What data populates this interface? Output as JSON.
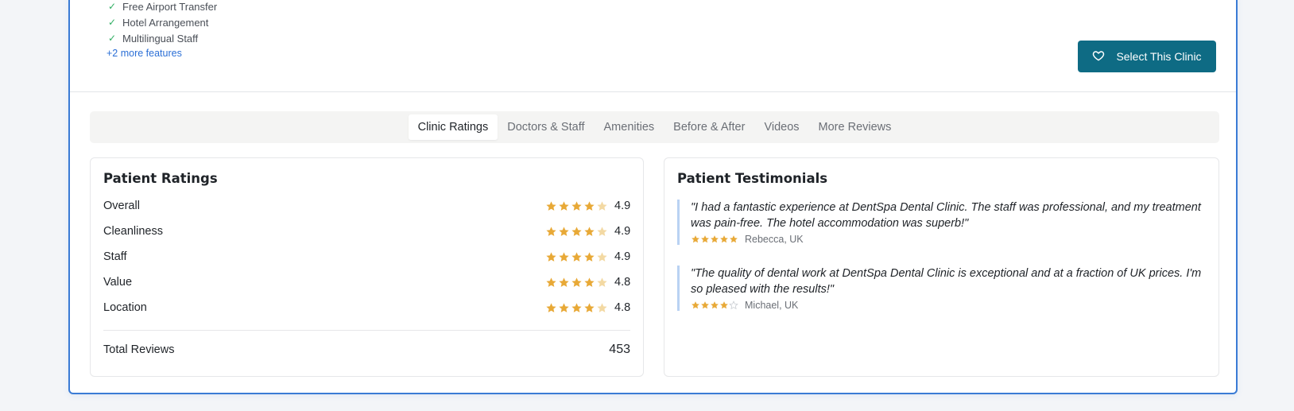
{
  "features": {
    "items": [
      "Free Airport Transfer",
      "Hotel Arrangement",
      "Multilingual Staff"
    ],
    "more_link": "+2 more features"
  },
  "select_button": {
    "label": "Select This Clinic",
    "icon": "heart-icon"
  },
  "tabs": [
    {
      "label": "Clinic Ratings",
      "active": true
    },
    {
      "label": "Doctors & Staff",
      "active": false
    },
    {
      "label": "Amenities",
      "active": false
    },
    {
      "label": "Before & After",
      "active": false
    },
    {
      "label": "Videos",
      "active": false
    },
    {
      "label": "More Reviews",
      "active": false
    }
  ],
  "ratings": {
    "title": "Patient Ratings",
    "rows": [
      {
        "label": "Overall",
        "value": "4.9",
        "stars": 4.9
      },
      {
        "label": "Cleanliness",
        "value": "4.9",
        "stars": 4.9
      },
      {
        "label": "Staff",
        "value": "4.9",
        "stars": 4.9
      },
      {
        "label": "Value",
        "value": "4.8",
        "stars": 4.8
      },
      {
        "label": "Location",
        "value": "4.8",
        "stars": 4.8
      }
    ],
    "total_label": "Total Reviews",
    "total_value": "453"
  },
  "testimonials": {
    "title": "Patient Testimonials",
    "items": [
      {
        "quote": "\"I had a fantastic experience at DentSpa Dental Clinic. The staff was professional, and my treatment was pain-free. The hotel accommodation was superb!\"",
        "author": "Rebecca, UK",
        "stars": 5
      },
      {
        "quote": "\"The quality of dental work at DentSpa Dental Clinic is exceptional and at a fraction of UK prices. I'm so pleased with the results!\"",
        "author": "Michael, UK",
        "stars": 4
      }
    ]
  },
  "colors": {
    "accent": "#0e6b84",
    "star": "#e8a937",
    "star_faded": "#f3d9a3",
    "check": "#2fae62",
    "link": "#2b6fd6",
    "card_border": "#3a7bd5"
  }
}
